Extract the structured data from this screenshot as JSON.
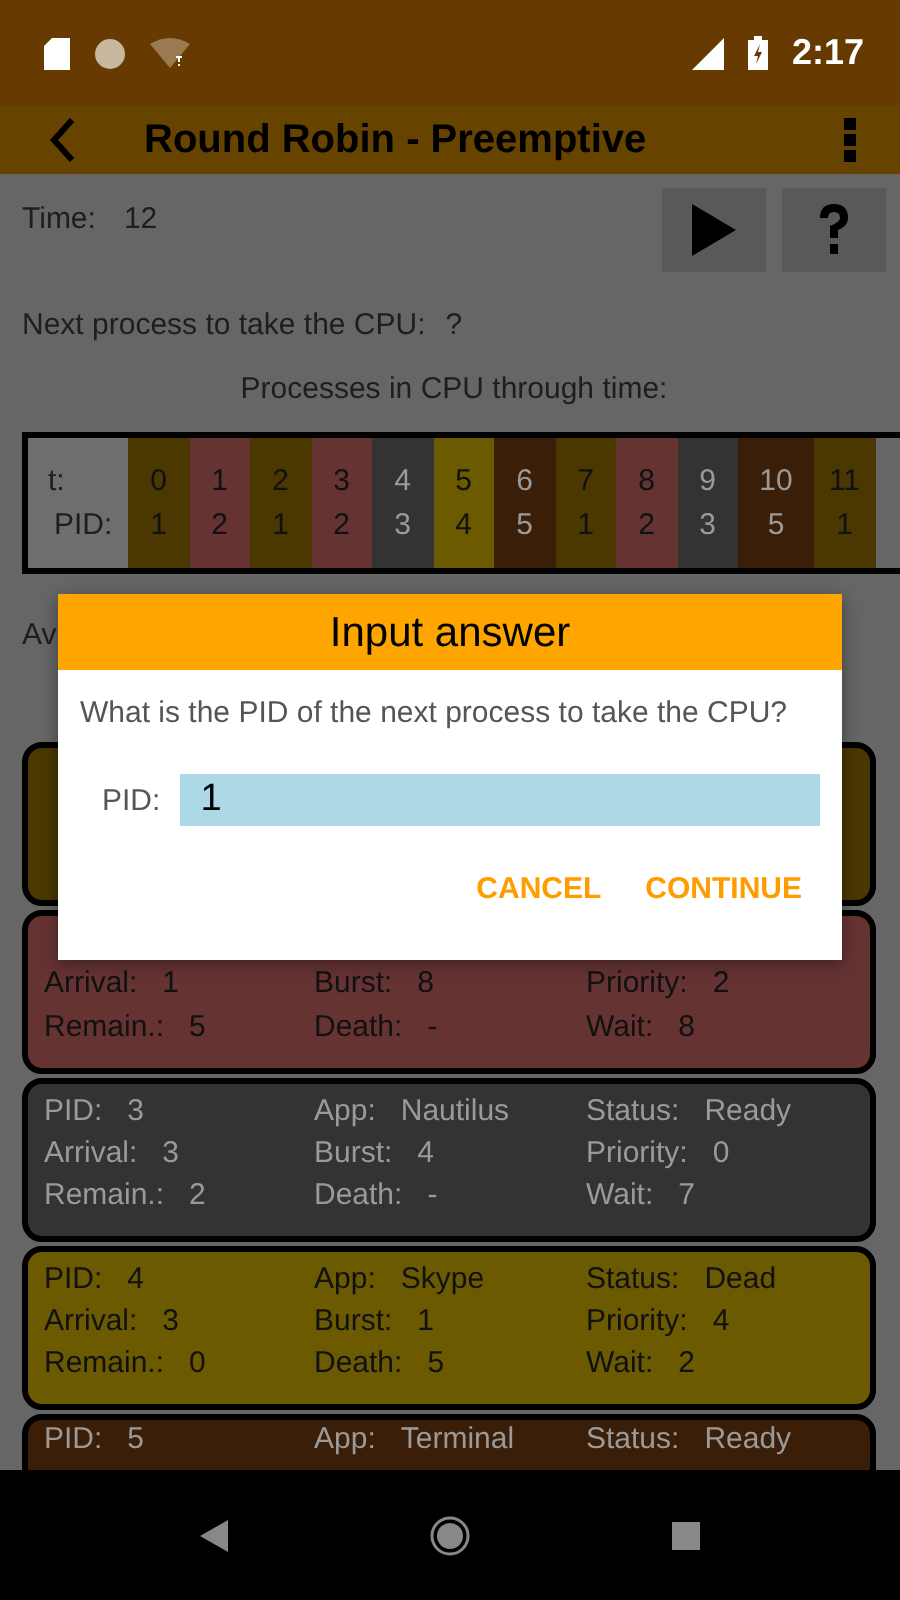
{
  "status_bar": {
    "time": "2:17"
  },
  "app_bar": {
    "title": "Round Robin - Preemptive"
  },
  "time": {
    "label": "Time:",
    "value": "12"
  },
  "next_process": {
    "label": "Next process to take the CPU:",
    "value": "?"
  },
  "timeline": {
    "title": "Processes in CPU through time:",
    "row_labels": [
      "t:",
      "PID:"
    ],
    "cells": [
      {
        "t": "0",
        "pid": "1",
        "color": "#4a3800"
      },
      {
        "t": "1",
        "pid": "2",
        "color": "#663333"
      },
      {
        "t": "2",
        "pid": "1",
        "color": "#4a3800"
      },
      {
        "t": "3",
        "pid": "2",
        "color": "#663333"
      },
      {
        "t": "4",
        "pid": "3",
        "color": "#333333"
      },
      {
        "t": "5",
        "pid": "4",
        "color": "#6b5a00"
      },
      {
        "t": "6",
        "pid": "5",
        "color": "#3a1e08"
      },
      {
        "t": "7",
        "pid": "1",
        "color": "#4a3800"
      },
      {
        "t": "8",
        "pid": "2",
        "color": "#663333"
      },
      {
        "t": "9",
        "pid": "3",
        "color": "#333333"
      },
      {
        "t": "10",
        "pid": "5",
        "color": "#3a1e08"
      },
      {
        "t": "11",
        "pid": "1",
        "color": "#4a3800"
      }
    ]
  },
  "average_label": "Av",
  "processes": [
    {
      "color": "#4a3800"
    },
    {
      "color": "#663333",
      "rows": [
        [
          {
            "label": "Arrival:",
            "value": "1"
          },
          {
            "label": "Burst:",
            "value": "8"
          },
          {
            "label": "Priority:",
            "value": "2"
          }
        ],
        [
          {
            "label": "Remain.:",
            "value": "5"
          },
          {
            "label": "Death:",
            "value": "-"
          },
          {
            "label": "Wait:",
            "value": "8"
          }
        ]
      ]
    },
    {
      "color": "#333333",
      "rows": [
        [
          {
            "label": "PID:",
            "value": "3"
          },
          {
            "label": "App:",
            "value": "Nautilus"
          },
          {
            "label": "Status:",
            "value": "Ready"
          }
        ],
        [
          {
            "label": "Arrival:",
            "value": "3"
          },
          {
            "label": "Burst:",
            "value": "4"
          },
          {
            "label": "Priority:",
            "value": "0"
          }
        ],
        [
          {
            "label": "Remain.:",
            "value": "2"
          },
          {
            "label": "Death:",
            "value": "-"
          },
          {
            "label": "Wait:",
            "value": "7"
          }
        ]
      ]
    },
    {
      "color": "#6b5a00",
      "rows": [
        [
          {
            "label": "PID:",
            "value": "4"
          },
          {
            "label": "App:",
            "value": "Skype"
          },
          {
            "label": "Status:",
            "value": "Dead"
          }
        ],
        [
          {
            "label": "Arrival:",
            "value": "3"
          },
          {
            "label": "Burst:",
            "value": "1"
          },
          {
            "label": "Priority:",
            "value": "4"
          }
        ],
        [
          {
            "label": "Remain.:",
            "value": "0"
          },
          {
            "label": "Death:",
            "value": "5"
          },
          {
            "label": "Wait:",
            "value": "2"
          }
        ]
      ]
    },
    {
      "color": "#3a1e08",
      "rows": [
        [
          {
            "label": "PID:",
            "value": "5"
          },
          {
            "label": "App:",
            "value": "Terminal"
          },
          {
            "label": "Status:",
            "value": "Ready"
          }
        ]
      ]
    }
  ],
  "dialog": {
    "title": "Input answer",
    "question": "What is the PID of the next process to take the CPU?",
    "field_label": "PID:",
    "field_value": "1",
    "buttons": [
      "CANCEL",
      "CONTINUE"
    ]
  }
}
